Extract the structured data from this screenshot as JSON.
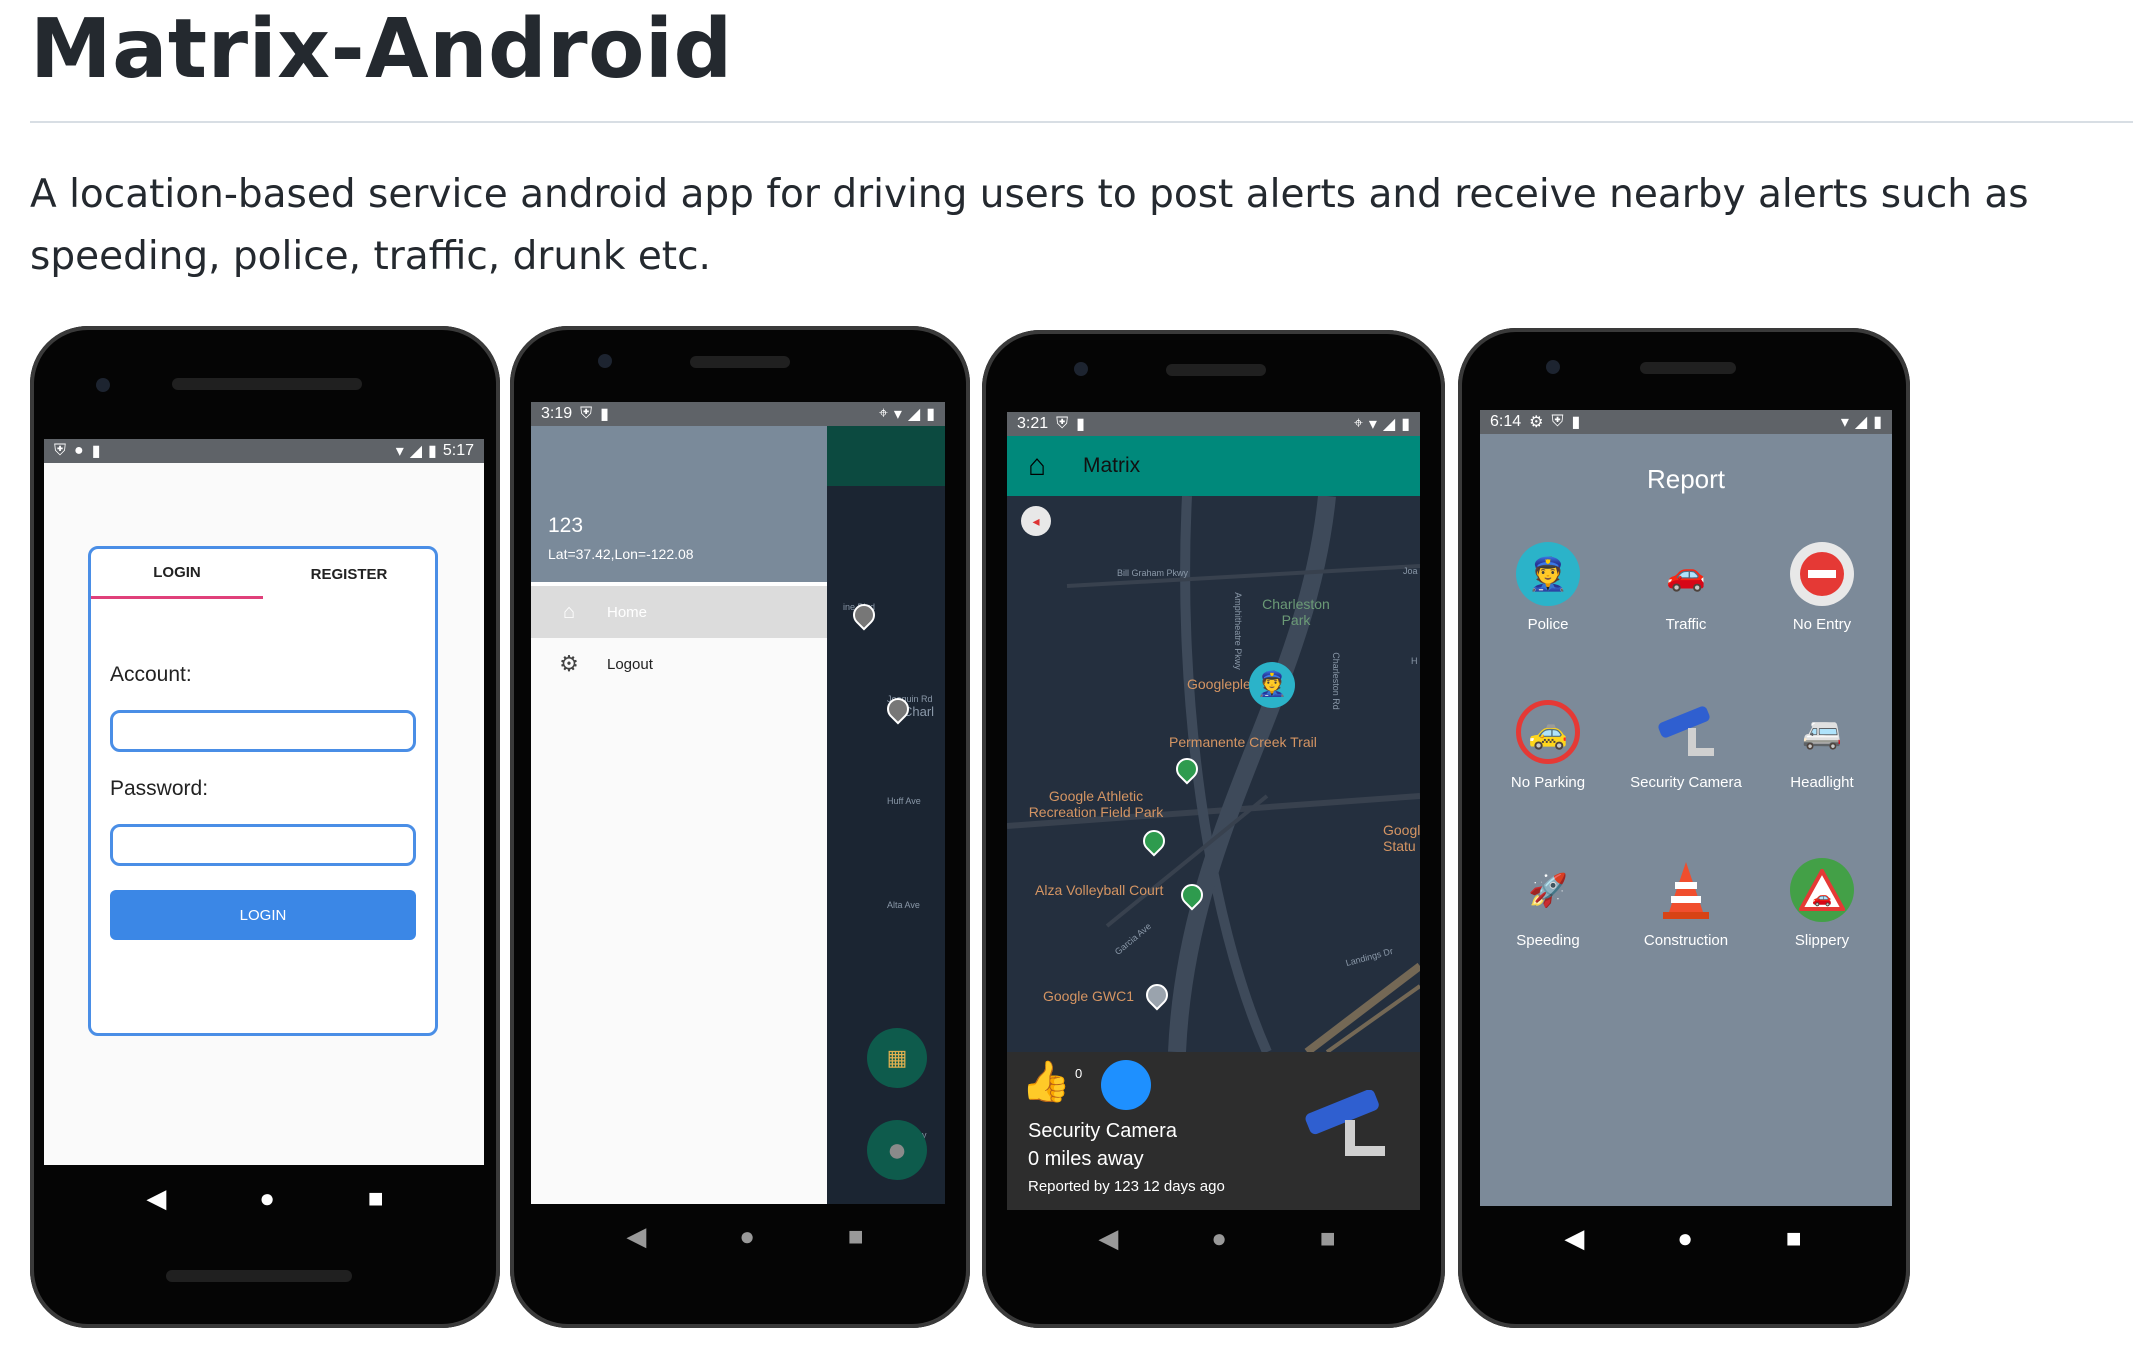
{
  "page": {
    "title": "Matrix-Android",
    "description": "A location-based service android app for driving users to post alerts and receive nearby alerts such as speeding, police, traffic, drunk etc."
  },
  "phone1": {
    "time": "5:17",
    "tab_login": "LOGIN",
    "tab_register": "REGISTER",
    "account_label": "Account:",
    "password_label": "Password:",
    "login_button": "LOGIN",
    "accent": "#3b87e6"
  },
  "phone2": {
    "time": "3:19",
    "user_name": "123",
    "coords": "Lat=37.42,Lon=-122.08",
    "menu": [
      {
        "label": "Home",
        "icon": "home-icon"
      },
      {
        "label": "Logout",
        "icon": "gear-icon"
      }
    ],
    "map_labels": [
      "ine Blvd",
      "Charl",
      "Joaquin Rd",
      "Huff Ave",
      "Alta Ave",
      "ey"
    ]
  },
  "phone3": {
    "time": "3:21",
    "app_title": "Matrix",
    "appbar_color": "#00897b",
    "map_labels": {
      "park1": "Charleston Park",
      "place1": "Googleplex",
      "trail": "Permanente Creek Trail",
      "park2": "Google Athletic Recreation Field Park",
      "court": "Alza Volleyball Court",
      "gwc": "Google GWC1",
      "goog_statue": "Googl Statu",
      "road1": "Bill Graham Pkwy",
      "road2": "Amphitheatre Pkwy",
      "road3": "Charleston Rd",
      "road4": "Garcia Ave",
      "road5": "Landings Dr",
      "road6": "Joa",
      "road7": "H"
    },
    "like_count": "0",
    "alert_title": "Security Camera",
    "alert_distance": "0 miles away",
    "alert_meta": "Reported by 123 12 days ago"
  },
  "phone4": {
    "time": "6:14",
    "heading": "Report",
    "items": [
      {
        "label": "Police",
        "icon": "police-icon"
      },
      {
        "label": "Traffic",
        "icon": "traffic-icon"
      },
      {
        "label": "No Entry",
        "icon": "no-entry-icon"
      },
      {
        "label": "No Parking",
        "icon": "no-parking-icon"
      },
      {
        "label": "Security Camera",
        "icon": "security-camera-icon"
      },
      {
        "label": "Headlight",
        "icon": "headlight-icon"
      },
      {
        "label": "Speeding",
        "icon": "speeding-icon"
      },
      {
        "label": "Construction",
        "icon": "construction-icon"
      },
      {
        "label": "Slippery",
        "icon": "slippery-icon"
      }
    ]
  }
}
